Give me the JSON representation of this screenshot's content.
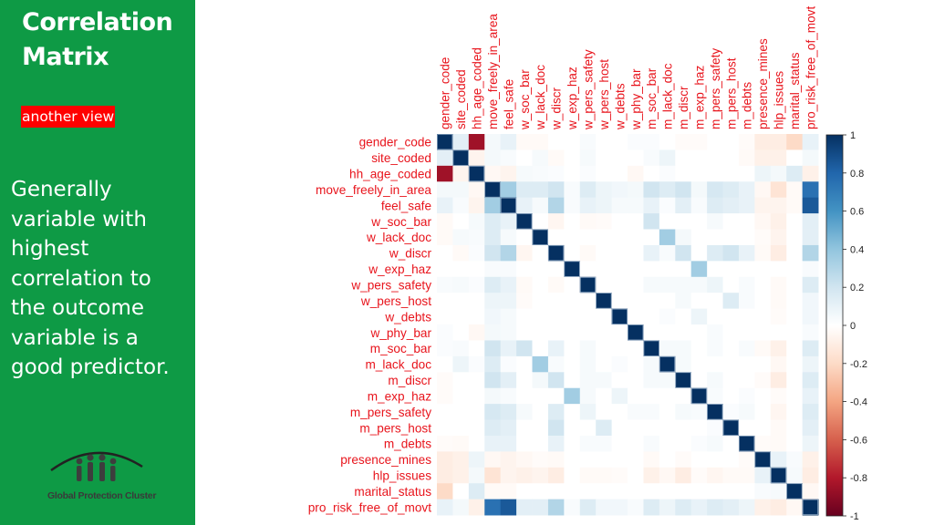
{
  "slide": {
    "title_line1": "Correlation",
    "title_line2": "Matrix",
    "badge": "another view",
    "body_lines": [
      "Generally",
      "variable with",
      "highest",
      "correlation to",
      "the outcome",
      "variable is a",
      "good predictor."
    ],
    "logo_text": "Global Protection Cluster",
    "colors": {
      "panel": "#0e9a45",
      "badge": "#ff0000",
      "label": "#e8141c"
    }
  },
  "chart_data": {
    "type": "heatmap",
    "title": "",
    "variables": [
      "gender_code",
      "site_coded",
      "hh_age_coded",
      "move_freely_in_area",
      "feel_safe",
      "w_soc_bar",
      "w_lack_doc",
      "w_discr",
      "w_exp_haz",
      "w_pers_safety",
      "w_pers_host",
      "w_debts",
      "w_phy_bar",
      "m_soc_bar",
      "m_lack_doc",
      "m_discr",
      "m_exp_haz",
      "m_pers_safety",
      "m_pers_host",
      "m_debts",
      "presence_mines",
      "hlp_issues",
      "marital_status",
      "pro_risk_free_of_movt"
    ],
    "colorbar": {
      "range": [
        -1,
        1
      ],
      "ticks": [
        "1",
        "0.8",
        "0.6",
        "0.4",
        "0.2",
        "0",
        "-0.2",
        "-0.4",
        "-0.6",
        "-0.8",
        "-1"
      ],
      "low_color": "#67001f",
      "mid_color": "#ffffff",
      "high_color": "#053061"
    },
    "matrix": [
      [
        1,
        0.12,
        -0.85,
        0.05,
        0.1,
        -0.03,
        -0.03,
        0,
        0,
        0.03,
        0,
        0,
        0.02,
        0.02,
        0,
        -0.02,
        -0.02,
        0,
        0,
        -0.02,
        -0.1,
        -0.1,
        -0.2,
        0.1
      ],
      [
        0.12,
        1,
        -0.06,
        0.05,
        0.03,
        0,
        0.04,
        -0.03,
        0,
        0.04,
        0,
        0,
        0,
        0.03,
        0.08,
        0,
        0,
        0,
        0,
        -0.03,
        -0.08,
        -0.08,
        0,
        0.05
      ],
      [
        -0.85,
        -0.06,
        1,
        -0.04,
        -0.06,
        0.04,
        0.03,
        0.02,
        0,
        0.02,
        0,
        0,
        -0.04,
        0,
        0.02,
        0,
        0,
        0,
        0,
        0,
        0.08,
        0.05,
        0.15,
        -0.08
      ],
      [
        0.05,
        0.05,
        -0.04,
        1,
        0.35,
        0.15,
        0.15,
        0.2,
        0.03,
        0.15,
        0.08,
        0.06,
        0.05,
        0.2,
        0.15,
        0.2,
        0.05,
        0.18,
        0.15,
        0.1,
        -0.04,
        -0.15,
        -0.03,
        0.75
      ],
      [
        0.1,
        0.03,
        -0.06,
        0.35,
        1,
        0.1,
        0.04,
        0.3,
        0.03,
        0.1,
        0.08,
        0.04,
        0.04,
        0.1,
        0.02,
        0.12,
        0.03,
        0.15,
        0.12,
        0.1,
        -0.06,
        -0.06,
        -0.03,
        0.85
      ],
      [
        -0.03,
        0,
        0.04,
        0.15,
        0.1,
        1,
        0,
        -0.05,
        0,
        -0.03,
        -0.02,
        0,
        0,
        0.2,
        0,
        0,
        0,
        0.04,
        0,
        0,
        -0.04,
        -0.08,
        0,
        0.12
      ],
      [
        -0.03,
        0.04,
        0.03,
        0.15,
        0.04,
        0,
        1,
        0,
        0,
        0,
        0,
        0,
        0,
        0,
        0.35,
        0.05,
        0,
        0,
        0,
        0,
        -0.02,
        -0.06,
        0,
        0.12
      ],
      [
        0,
        -0.03,
        0.02,
        0.2,
        0.3,
        -0.05,
        0,
        1,
        0,
        -0.03,
        0,
        0,
        0,
        0.1,
        0.03,
        0.2,
        0,
        0.15,
        0.2,
        0.1,
        -0.03,
        -0.1,
        0,
        0.3
      ],
      [
        0,
        0,
        0,
        0.03,
        0.03,
        0,
        0,
        0,
        1,
        0,
        0,
        0,
        0,
        0,
        0,
        0,
        0.35,
        0,
        0,
        0,
        0,
        0,
        0,
        0.03
      ],
      [
        0.03,
        0.04,
        0.02,
        0.15,
        0.1,
        -0.03,
        0,
        -0.03,
        0,
        1,
        0,
        0,
        0,
        0.04,
        0.04,
        0.04,
        0.04,
        0.08,
        0,
        0.03,
        0,
        -0.03,
        0,
        0.15
      ],
      [
        0,
        0,
        0,
        0.08,
        0.08,
        -0.02,
        0,
        0,
        0,
        0,
        1,
        0,
        0,
        0,
        0,
        0.04,
        0,
        0,
        0.15,
        0.03,
        0,
        -0.03,
        0,
        0.06
      ],
      [
        0,
        0,
        0,
        0.06,
        0.04,
        0,
        0,
        0,
        0,
        0,
        0,
        1,
        0,
        0,
        0.02,
        0,
        0.08,
        0,
        0,
        0,
        0,
        -0.02,
        0,
        0.06
      ],
      [
        0.02,
        0,
        -0.04,
        0.05,
        0.04,
        0,
        0,
        0,
        0,
        0,
        0,
        0,
        1,
        0,
        0,
        0,
        0,
        0.03,
        0,
        0,
        0,
        0,
        0,
        0.03
      ],
      [
        0.02,
        0.03,
        0,
        0.2,
        0.1,
        0.2,
        0,
        0.1,
        0,
        0.04,
        0,
        0,
        0,
        1,
        0.04,
        0.04,
        0,
        0.03,
        0,
        0.03,
        -0.03,
        -0.08,
        0,
        0.15
      ],
      [
        0,
        0.08,
        0.02,
        0.15,
        0.02,
        0,
        0.35,
        0.03,
        0,
        0.04,
        0,
        0.02,
        0,
        0.04,
        1,
        0.04,
        0,
        0,
        0,
        0,
        0,
        -0.04,
        0,
        0.08
      ],
      [
        -0.02,
        0,
        0,
        0.2,
        0.12,
        0,
        0.05,
        0.2,
        0,
        0.04,
        0.04,
        0,
        0,
        0.04,
        0.04,
        1,
        0,
        0.04,
        0,
        0,
        -0.02,
        -0.1,
        0,
        0.15
      ],
      [
        -0.02,
        0,
        0,
        0.05,
        0.03,
        0,
        0,
        0,
        0.35,
        0.04,
        0,
        0.08,
        0,
        0,
        0,
        0,
        1,
        0.03,
        0,
        0.02,
        0,
        -0.02,
        0,
        0.1
      ],
      [
        0,
        0,
        0,
        0.18,
        0.15,
        0.04,
        0,
        0.15,
        0,
        0.08,
        0,
        0,
        0.03,
        0.03,
        0,
        0.04,
        0.03,
        1,
        0.02,
        0.04,
        0,
        -0.05,
        0,
        0.15
      ],
      [
        0,
        0,
        0,
        0.15,
        0.12,
        0,
        0,
        0.2,
        0,
        0,
        0.15,
        0,
        0,
        0,
        0,
        0,
        0,
        0.02,
        1,
        0,
        0,
        -0.03,
        0,
        0.12
      ],
      [
        -0.02,
        -0.03,
        0,
        0.1,
        0.1,
        0,
        0,
        0.1,
        0,
        0.03,
        0.03,
        0,
        0,
        0.03,
        0,
        0,
        0.02,
        0.04,
        0,
        1,
        -0.02,
        -0.03,
        0,
        0.08
      ],
      [
        -0.1,
        -0.08,
        0.08,
        -0.04,
        -0.06,
        -0.04,
        -0.02,
        -0.03,
        0,
        0,
        0,
        0,
        0,
        -0.03,
        0,
        -0.02,
        0,
        0,
        0,
        -0.02,
        1,
        0.1,
        0.03,
        -0.08
      ],
      [
        -0.1,
        -0.08,
        0.05,
        -0.15,
        -0.06,
        -0.08,
        -0.06,
        -0.1,
        0,
        -0.03,
        -0.03,
        -0.02,
        0,
        -0.08,
        -0.04,
        -0.1,
        -0.02,
        -0.05,
        -0.03,
        -0.03,
        0.1,
        1,
        0.04,
        -0.1
      ],
      [
        -0.2,
        0,
        0.15,
        -0.03,
        -0.03,
        0,
        0,
        0,
        0,
        0,
        0,
        0,
        0,
        0,
        0,
        0,
        0,
        0,
        0,
        0,
        0.03,
        0.04,
        1,
        -0.04
      ],
      [
        0.1,
        0.05,
        -0.08,
        0.75,
        0.85,
        0.12,
        0.12,
        0.3,
        0.03,
        0.15,
        0.06,
        0.06,
        0.03,
        0.15,
        0.08,
        0.15,
        0.1,
        0.15,
        0.12,
        0.08,
        -0.08,
        -0.1,
        -0.04,
        1
      ]
    ]
  }
}
